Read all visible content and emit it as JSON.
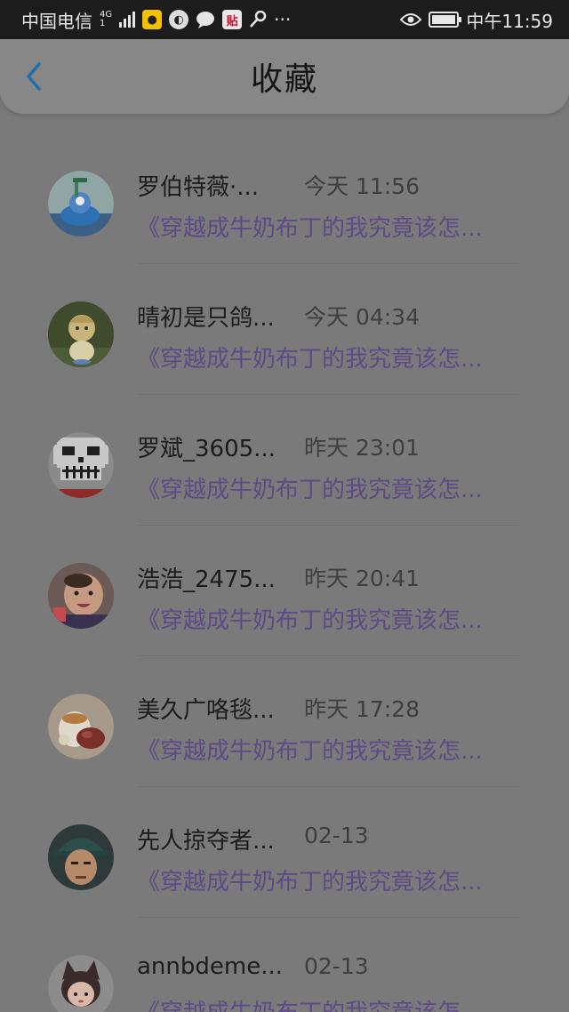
{
  "status_bar": {
    "carrier": "中国电信",
    "network": "4G",
    "network_sub": "1",
    "time": "中午11:59",
    "icons": [
      "signal-icon",
      "cat-app-icon",
      "browser-icon",
      "chat-icon",
      "tieba-icon",
      "key-icon",
      "more-icon",
      "eye-icon",
      "battery-icon"
    ],
    "tieba_glyph": "贴",
    "more": "···"
  },
  "header": {
    "title": "收藏",
    "back_icon": "chevron-left-icon",
    "accent": "#1e6ea8"
  },
  "items": [
    {
      "name": "罗伯特薇·...",
      "time": "今天 11:56",
      "excerpt": "《穿越成牛奶布丁的我究竟该怎...",
      "avatar": "avatar-blue-character"
    },
    {
      "name": "晴初是只鸽...",
      "time": "今天 04:34",
      "excerpt": "《穿越成牛奶布丁的我究竟该怎...",
      "avatar": "avatar-anime-girl"
    },
    {
      "name": "罗斌_3605...",
      "time": "昨天 23:01",
      "excerpt": "《穿越成牛奶布丁的我究竟该怎...",
      "avatar": "avatar-pixel-skull"
    },
    {
      "name": "浩浩_2475...",
      "time": "昨天 20:41",
      "excerpt": "《穿越成牛奶布丁的我究竟该怎...",
      "avatar": "avatar-baby"
    },
    {
      "name": "美久广咯毯...",
      "time": "昨天 17:28",
      "excerpt": "《穿越成牛奶布丁的我究竟该怎...",
      "avatar": "avatar-dessert"
    },
    {
      "name": "先人掠夺者...",
      "time": "02-13",
      "excerpt": "《穿越成牛奶布丁的我究竟该怎...",
      "avatar": "avatar-soldier"
    },
    {
      "name": "annbdeme...",
      "time": "02-13",
      "excerpt": "《穿越成牛奶布丁的我究竟该怎...",
      "avatar": "avatar-cat-girl"
    }
  ],
  "colors": {
    "excerpt": "#5e4a86",
    "overlay": "#7a7a7a",
    "status_bar": "#1c1c1c"
  }
}
